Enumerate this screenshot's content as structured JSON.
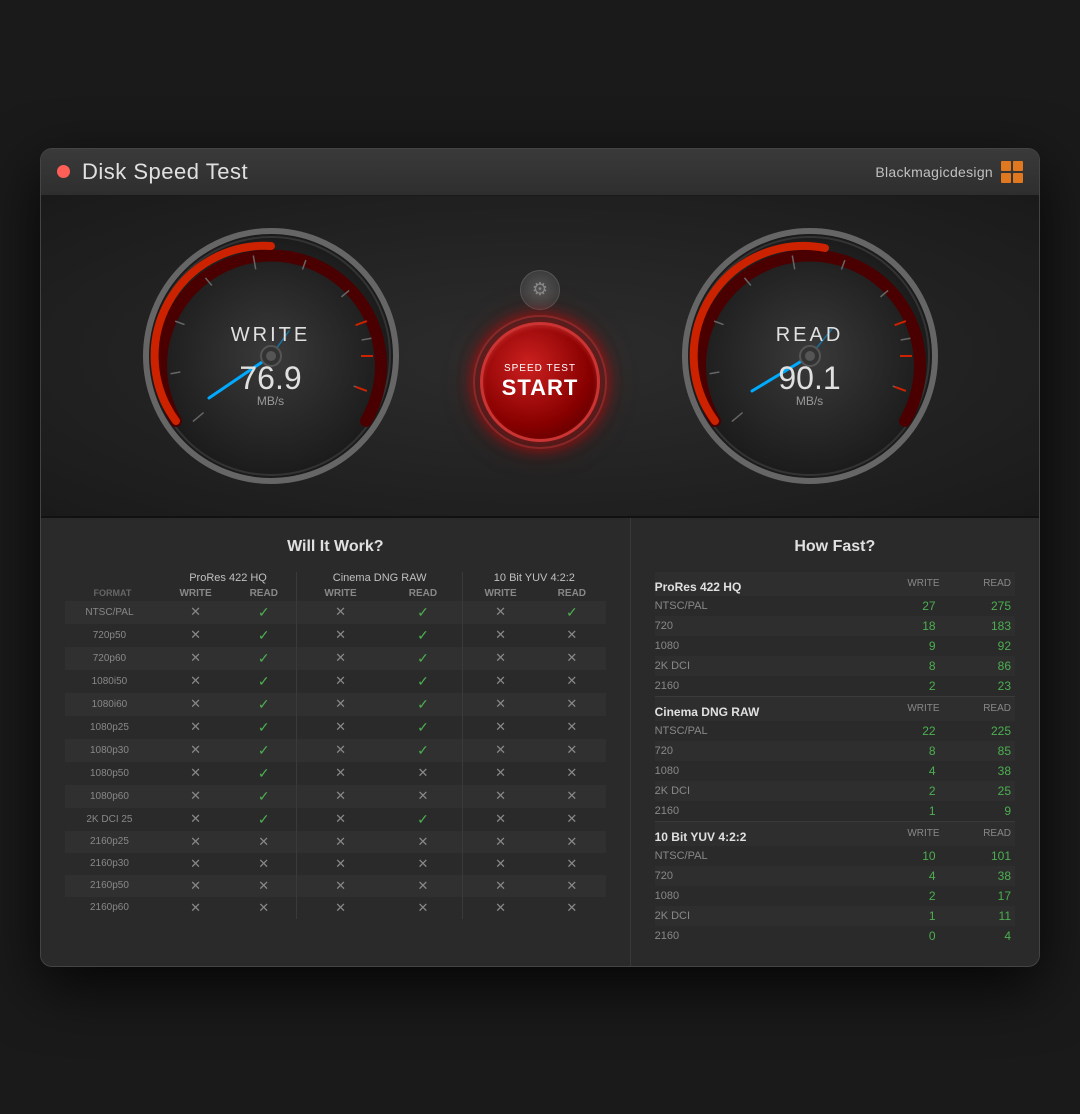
{
  "window": {
    "title": "Disk Speed Test",
    "brand": "Blackmagicdesign"
  },
  "gauges": {
    "write": {
      "label": "WRITE",
      "value": "76.9",
      "unit": "MB/s",
      "needle_angle": -30
    },
    "read": {
      "label": "READ",
      "value": "90.1",
      "unit": "MB/s",
      "needle_angle": -20
    },
    "start_button": {
      "line1": "SPEED TEST",
      "line2": "START"
    }
  },
  "left_panel": {
    "title": "Will It Work?",
    "columns": {
      "format": "FORMAT",
      "group1": "ProRes 422 HQ",
      "group2": "Cinema DNG RAW",
      "group3": "10 Bit YUV 4:2:2"
    },
    "sub_cols": [
      "WRITE",
      "READ",
      "WRITE",
      "READ",
      "WRITE",
      "READ"
    ],
    "rows": [
      {
        "label": "NTSC/PAL",
        "vals": [
          "x",
          "c",
          "x",
          "c",
          "x",
          "c"
        ]
      },
      {
        "label": "720p50",
        "vals": [
          "x",
          "c",
          "x",
          "c",
          "x",
          "x"
        ]
      },
      {
        "label": "720p60",
        "vals": [
          "x",
          "c",
          "x",
          "c",
          "x",
          "x"
        ]
      },
      {
        "label": "1080i50",
        "vals": [
          "x",
          "c",
          "x",
          "c",
          "x",
          "x"
        ]
      },
      {
        "label": "1080i60",
        "vals": [
          "x",
          "c",
          "x",
          "c",
          "x",
          "x"
        ]
      },
      {
        "label": "1080p25",
        "vals": [
          "x",
          "c",
          "x",
          "c",
          "x",
          "x"
        ]
      },
      {
        "label": "1080p30",
        "vals": [
          "x",
          "c",
          "x",
          "c",
          "x",
          "x"
        ]
      },
      {
        "label": "1080p50",
        "vals": [
          "x",
          "c",
          "x",
          "x",
          "x",
          "x"
        ]
      },
      {
        "label": "1080p60",
        "vals": [
          "x",
          "c",
          "x",
          "x",
          "x",
          "x"
        ]
      },
      {
        "label": "2K DCI 25",
        "vals": [
          "x",
          "c",
          "x",
          "c",
          "x",
          "x"
        ]
      },
      {
        "label": "2160p25",
        "vals": [
          "x",
          "x",
          "x",
          "x",
          "x",
          "x"
        ]
      },
      {
        "label": "2160p30",
        "vals": [
          "x",
          "x",
          "x",
          "x",
          "x",
          "x"
        ]
      },
      {
        "label": "2160p50",
        "vals": [
          "x",
          "x",
          "x",
          "x",
          "x",
          "x"
        ]
      },
      {
        "label": "2160p60",
        "vals": [
          "x",
          "x",
          "x",
          "x",
          "x",
          "x"
        ]
      }
    ]
  },
  "right_panel": {
    "title": "How Fast?",
    "sections": [
      {
        "name": "ProRes 422 HQ",
        "rows": [
          {
            "label": "NTSC/PAL",
            "write": 27,
            "read": 275
          },
          {
            "label": "720",
            "write": 18,
            "read": 183
          },
          {
            "label": "1080",
            "write": 9,
            "read": 92
          },
          {
            "label": "2K DCI",
            "write": 8,
            "read": 86
          },
          {
            "label": "2160",
            "write": 2,
            "read": 23
          }
        ]
      },
      {
        "name": "Cinema DNG RAW",
        "rows": [
          {
            "label": "NTSC/PAL",
            "write": 22,
            "read": 225
          },
          {
            "label": "720",
            "write": 8,
            "read": 85
          },
          {
            "label": "1080",
            "write": 4,
            "read": 38
          },
          {
            "label": "2K DCI",
            "write": 2,
            "read": 25
          },
          {
            "label": "2160",
            "write": 1,
            "read": 9
          }
        ]
      },
      {
        "name": "10 Bit YUV 4:2:2",
        "rows": [
          {
            "label": "NTSC/PAL",
            "write": 10,
            "read": 101
          },
          {
            "label": "720",
            "write": 4,
            "read": 38
          },
          {
            "label": "1080",
            "write": 2,
            "read": 17
          },
          {
            "label": "2K DCI",
            "write": 1,
            "read": 11
          },
          {
            "label": "2160",
            "write": 0,
            "read": 4
          }
        ]
      }
    ],
    "col_write": "WRITE",
    "col_read": "READ"
  }
}
